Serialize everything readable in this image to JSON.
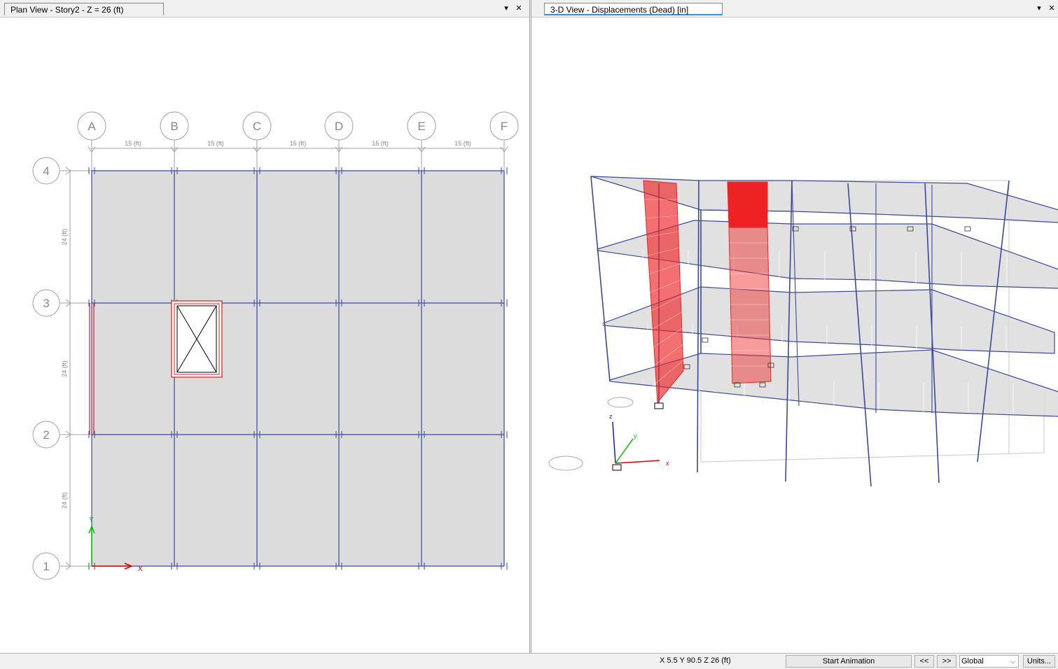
{
  "left_view": {
    "tab_title": "Plan View - Story2 - Z = 26 (ft)",
    "grid_columns": [
      "A",
      "B",
      "C",
      "D",
      "E",
      "F"
    ],
    "grid_rows": [
      "4",
      "3",
      "2",
      "1"
    ],
    "column_spacing_label": "15 (ft)",
    "row_spacing_label": "24 (ft)",
    "axis_x_label": "X",
    "axis_y_label": "Y"
  },
  "right_view": {
    "tab_title": "3-D View   - Displacements (Dead)  [in]",
    "axis_x_label": "x",
    "axis_y_label": "y",
    "axis_z_label": "z"
  },
  "window_buttons": {
    "dropdown_icon": "▾",
    "close_icon": "✕"
  },
  "status_bar": {
    "coordinates": "X 5.5  Y 90.5  Z 26 (ft)",
    "start_animation": "Start Animation",
    "prev": "<<",
    "next": ">>",
    "coord_system": "Global",
    "units": "Units..."
  },
  "colors": {
    "frame": "#3a4a9a",
    "slab": "#dcdcdc",
    "wall": "#ee2222",
    "grid": "#a0a0a0"
  }
}
